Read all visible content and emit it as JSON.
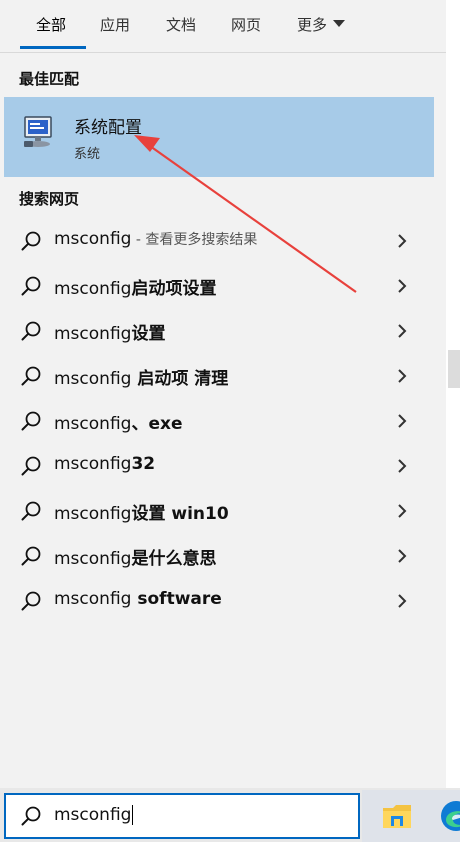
{
  "tabs": [
    {
      "label": "全部",
      "active": true
    },
    {
      "label": "应用",
      "active": false
    },
    {
      "label": "文档",
      "active": false
    },
    {
      "label": "网页",
      "active": false
    },
    {
      "label": "更多",
      "active": false
    }
  ],
  "best_match": {
    "section_title": "最佳匹配",
    "title": "系统配置",
    "subtitle": "系统",
    "icon": "system-config-icon"
  },
  "web": {
    "section_title": "搜索网页",
    "results": [
      {
        "query": "msconfig",
        "bold": "",
        "hint": " - 查看更多搜索结果"
      },
      {
        "query": "msconfig",
        "bold": "启动项设置",
        "hint": ""
      },
      {
        "query": "msconfig",
        "bold": "设置",
        "hint": ""
      },
      {
        "query": "msconfig",
        "bold": " 启动项 清理",
        "hint": ""
      },
      {
        "query": "msconfig",
        "bold": "、exe",
        "hint": ""
      },
      {
        "query": "msconfig",
        "bold": "32",
        "hint": ""
      },
      {
        "query": "msconfig",
        "bold": "设置 win10",
        "hint": ""
      },
      {
        "query": "msconfig",
        "bold": "是什么意思",
        "hint": ""
      },
      {
        "query": "msconfig",
        "bold": " software",
        "hint": ""
      }
    ]
  },
  "search": {
    "value": "msconfig",
    "icon": "search-icon"
  },
  "taskbar": {
    "icons": [
      "file-explorer-icon",
      "edge-icon"
    ]
  },
  "colors": {
    "panel": "#f2f2f2",
    "highlight": "#a7cbe8",
    "accent": "#0067c0",
    "annotation": "#e8413c"
  }
}
